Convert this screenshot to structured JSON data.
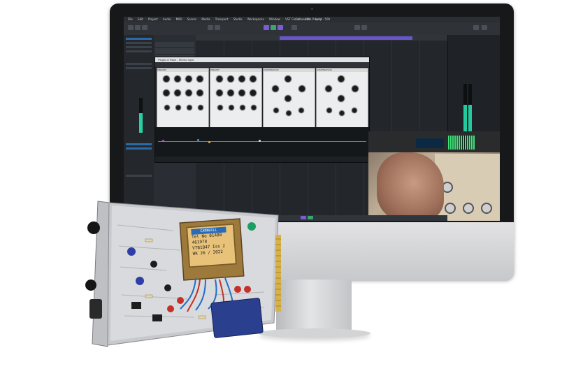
{
  "daw": {
    "window_title": "Cubase Pro Project - 500",
    "menu": [
      "File",
      "Edit",
      "Project",
      "Audio",
      "MIDI",
      "Scores",
      "Media",
      "Transport",
      "Studio",
      "Workspaces",
      "Window",
      "VST Cloud",
      "Hub",
      "Help"
    ],
    "plugin_window_title": "Plugin-In Rack - Stereo Input",
    "plugin_units": [
      "PREAMP",
      "PREAMP",
      "COMPRESSOR",
      "COMPRESSOR"
    ]
  },
  "module": {
    "sticker_brand": "CARNHILL",
    "sticker_lines": [
      "Tel No 01480 461978",
      "VTB1847 Iss 2",
      "WK 26 / 2022"
    ]
  },
  "colors": {
    "accent_purple": "#7c5bd6",
    "meter_green": "#28d1a5",
    "module_panel": "#c8c9cc",
    "transformer_copper": "#c79a45"
  }
}
